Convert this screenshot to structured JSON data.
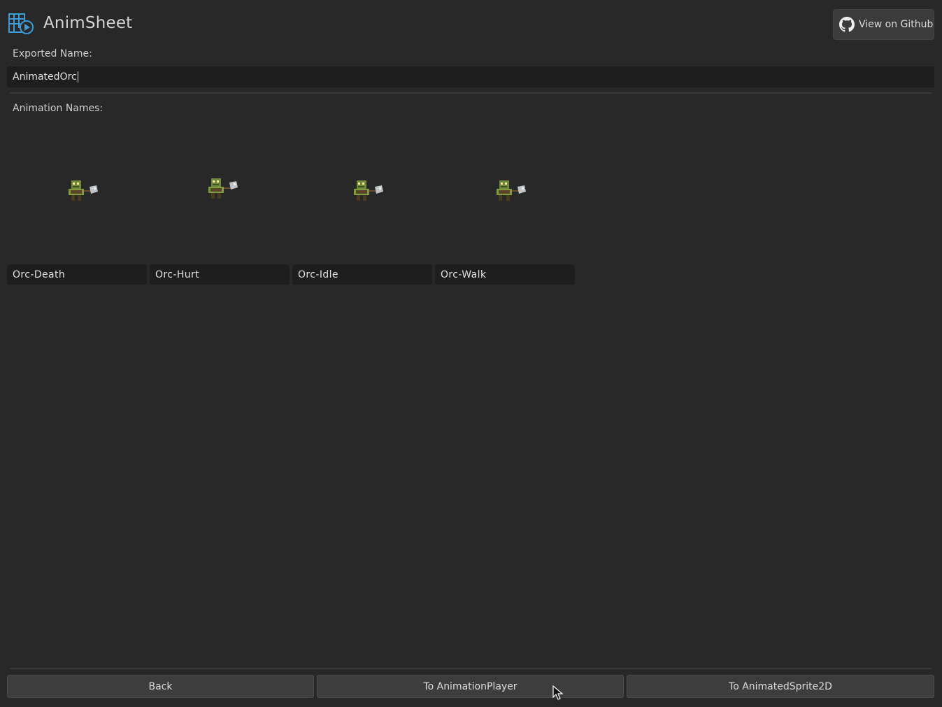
{
  "app": {
    "title": "AnimSheet",
    "logo_icon": "animsheet-logo-icon",
    "accent_color": "#3d9bd6"
  },
  "header": {
    "github_button": {
      "label": "View on Github",
      "icon": "github-icon"
    }
  },
  "exported_name": {
    "label": "Exported Name:",
    "value": "AnimatedOrc"
  },
  "animations": {
    "label": "Animation Names:",
    "items": [
      {
        "name": "Orc-Death",
        "icon": "orc-sprite-icon"
      },
      {
        "name": "Orc-Hurt",
        "icon": "orc-sprite-icon"
      },
      {
        "name": "Orc-Idle",
        "icon": "orc-sprite-icon"
      },
      {
        "name": "Orc-Walk",
        "icon": "orc-sprite-icon"
      }
    ]
  },
  "footer": {
    "back_label": "Back",
    "animation_player_label": "To AnimationPlayer",
    "animated_sprite_label": "To AnimatedSprite2D"
  }
}
